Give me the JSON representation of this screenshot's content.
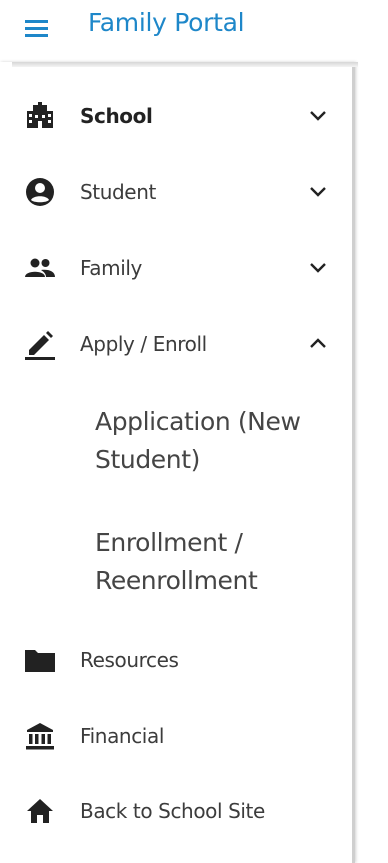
{
  "header": {
    "menu_icon": "hamburger-menu-icon",
    "title": "Family Portal",
    "accent_color": "#1e87c9"
  },
  "nav": {
    "items": [
      {
        "label": "School",
        "icon": "school-building-icon",
        "chevron": "chevron-down",
        "bold": true
      },
      {
        "label": "Student",
        "icon": "account-circle-icon",
        "chevron": "chevron-down"
      },
      {
        "label": "Family",
        "icon": "people-icon",
        "chevron": "chevron-down"
      },
      {
        "label": "Apply / Enroll",
        "icon": "pencil-icon",
        "chevron": "chevron-up",
        "expanded": true
      },
      {
        "label": "Resources",
        "icon": "folder-icon"
      },
      {
        "label": "Financial",
        "icon": "bank-icon"
      },
      {
        "label": "Back to School Site",
        "icon": "home-icon"
      }
    ],
    "apply_enroll_subitems": [
      {
        "label": "Application (New Student)"
      },
      {
        "label": "Enrollment / Reenrollment"
      }
    ]
  }
}
